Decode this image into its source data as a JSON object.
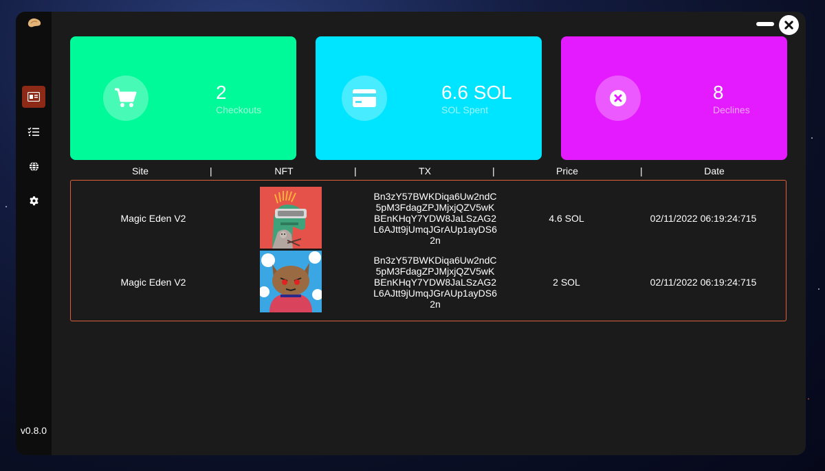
{
  "app": {
    "version": "v0.8.0"
  },
  "sidebar": {
    "items": [
      {
        "icon": "id-card-icon",
        "active": true
      },
      {
        "icon": "tasks-icon",
        "active": false
      },
      {
        "icon": "globe-icon",
        "active": false
      },
      {
        "icon": "gear-icon",
        "active": false
      }
    ]
  },
  "stats": [
    {
      "value": "2",
      "label": "Checkouts",
      "icon": "cart-icon",
      "color": "#00fa9a"
    },
    {
      "value": "6.6 SOL",
      "label": "SOL Spent",
      "icon": "credit-card-icon",
      "color": "#00e5ff"
    },
    {
      "value": "8",
      "label": "Declines",
      "icon": "x-circle-icon",
      "color": "#e41aff"
    }
  ],
  "table": {
    "columns": [
      "Site",
      "NFT",
      "TX",
      "Price",
      "Date"
    ],
    "separator": "|",
    "rows": [
      {
        "site": "Magic Eden V2",
        "nft": "dino-nft-image",
        "tx": "Bn3zY57BWKDiqa6Uw2ndC5pM3FdagZPJMjxjQZV5wKBEnKHqY7YDW8JaLSzAG2L6AJtt9jUmqJGrAUp1ayDS62n",
        "price": "4.6 SOL",
        "date": "02/11/2022 06:19:24:715"
      },
      {
        "site": "Magic Eden V2",
        "nft": "cat-nft-image",
        "tx": "Bn3zY57BWKDiqa6Uw2ndC5pM3FdagZPJMjxjQZV5wKBEnKHqY7YDW8JaLSzAG2L6AJtt9jUmqJGrAUp1ayDS62n",
        "price": "2 SOL",
        "date": "02/11/2022 06:19:24:715"
      }
    ]
  },
  "colors": {
    "accent": "#8c2a17",
    "border": "#e0603e",
    "panel": "#1b1b1b",
    "sidebar": "#0d0d0d"
  }
}
